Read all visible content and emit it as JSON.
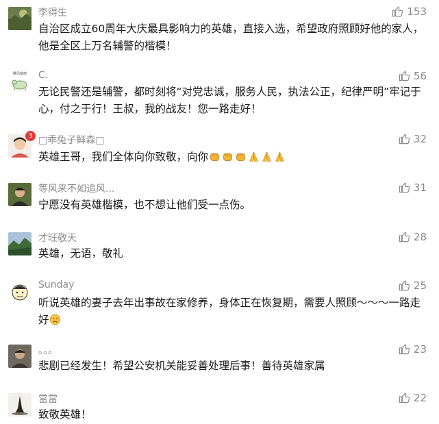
{
  "comments": [
    {
      "name": "李得生",
      "likes": "153",
      "text": "自治区成立60周年大庆最具影响力的英雄，直接入选，希望政府照顾好他的家人，他是全区上万名辅警的楷模！"
    },
    {
      "name": "C.",
      "likes": "56",
      "text": "无论民警还是辅警，都时刻将“对党忠诚，服务人民，执法公正，纪律严明”牢记于心，付之于行！王叔，我的战友！您一路走好！",
      "avatar_label": "腾讯家族"
    },
    {
      "name": "□乖兔子鲜森□",
      "likes": "32",
      "text": "英雄王哥，我们全体向你致敬，向你",
      "emoji": [
        "fist-icon",
        "fist-icon",
        "fist-icon",
        "pray-icon",
        "pray-icon",
        "pray-icon"
      ],
      "avatar_badge": "3"
    },
    {
      "name": "等风来不如追风...",
      "likes": "31",
      "text": "宁愿没有英雄楷模，也不想让他们受一点伤。"
    },
    {
      "name": "才旺敬天",
      "likes": "28",
      "text": "英雄，无语，敬礼"
    },
    {
      "name": "Sunday",
      "likes": "25",
      "text": "听说英雄的妻子去年出事故在家修养，身体正在恢复期，需要人照顾～～～一路走好",
      "emoji": [
        "sad-face-icon"
      ]
    },
    {
      "name": "。。。",
      "likes": "23",
      "text": "悲剧已经发生！希望公安机关能妥善处理后事！善待英雄家属"
    },
    {
      "name": "當當",
      "likes": "22",
      "text": "致敬英雄！"
    }
  ],
  "colors": {
    "name": "#8c8c8c",
    "text": "#1c1c1c",
    "like_icon": "#8a8a8a",
    "background": "#ffffff"
  }
}
